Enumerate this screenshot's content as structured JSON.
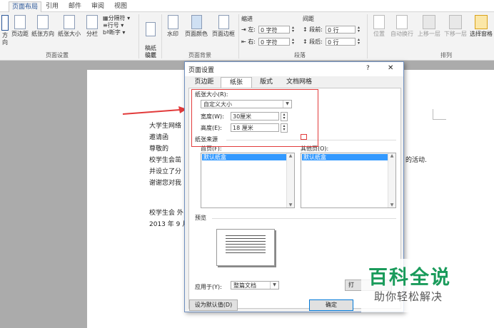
{
  "ribbon_tabs": [
    "页面布局",
    "引用",
    "邮件",
    "审阅",
    "视图"
  ],
  "ribbon": {
    "buttons": [
      "方向",
      "页边距",
      "纸张方向",
      "纸张大小",
      "分栏",
      "稿纸\n设置",
      "水印",
      "页面颜色",
      "页面边框",
      "位置",
      "自动换行",
      "上移一层",
      "下移一层",
      "选择窗格"
    ],
    "small_items": [
      "分隔符",
      "行号",
      "断字"
    ],
    "groups": [
      "页面设置",
      "稿纸",
      "页面背景",
      "段落",
      "排列"
    ],
    "indent_title": "缩进",
    "spacing_title": "间距",
    "indent_left_label": "左:",
    "indent_left_value": "0 字符",
    "indent_right_label": "右:",
    "indent_right_value": "0 字符",
    "spacing_before_label": "段前:",
    "spacing_before_value": "0 行",
    "spacing_after_label": "段后:",
    "spacing_after_value": "0 行"
  },
  "document_lines": [
    "大学生网络",
    "邀请函",
    "尊敬的",
    "校学生会茁",
    "并设立了分",
    "谢谢您对我",
    "",
    "",
    "校学生会 外",
    "2013 年 9 月"
  ],
  "doc_tail_text": "的活动.",
  "dialog": {
    "title": "页面设置",
    "help": "?",
    "close": "✕",
    "tabs": [
      "页边距",
      "纸张",
      "版式",
      "文档网格"
    ],
    "active_tab": 1,
    "paper_size_label": "纸张大小(R):",
    "paper_size_value": "自定义大小",
    "width_label": "宽度(W):",
    "width_value": "30厘米",
    "height_label": "高度(E):",
    "height_value": "18 厘米",
    "source_label": "纸张来源",
    "first_page_label": "首页(F):",
    "first_page_selected": "默认纸盒",
    "other_pages_label": "其他页(O):",
    "other_pages_selected": "默认纸盒",
    "preview_label": "预览",
    "apply_label": "应用于(Y):",
    "apply_value": "整篇文档",
    "print_btn_partial": "打",
    "default_btn": "设为默认值(D)",
    "ok_btn": "确定"
  },
  "watermark": {
    "title": "百科全说",
    "subtitle": "助你轻松解决"
  },
  "colors": {
    "accent": "#2b579a",
    "annotation_red": "#e23b3b",
    "watermark_green": "#1a9b5b"
  }
}
